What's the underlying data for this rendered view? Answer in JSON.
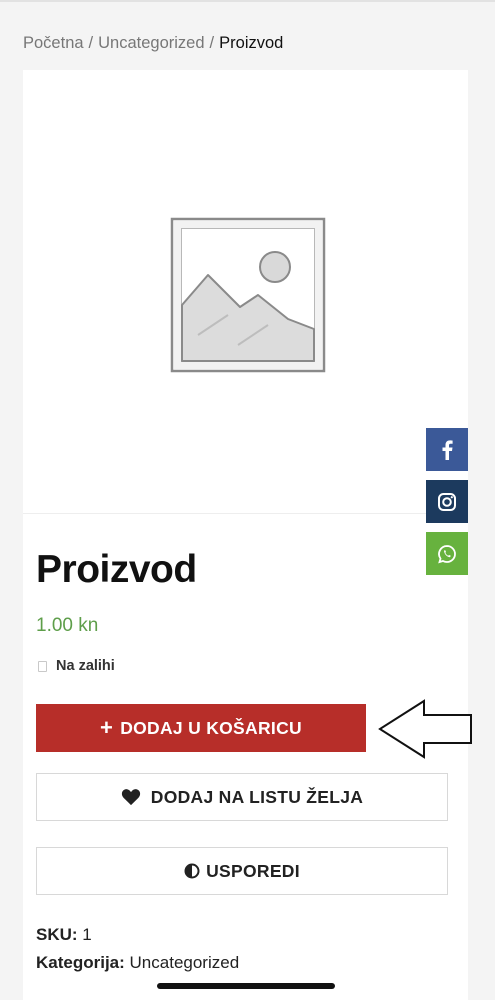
{
  "breadcrumb": {
    "home": "Početna",
    "separator": "/",
    "category": "Uncategorized",
    "current": "Proizvod"
  },
  "product": {
    "title": "Proizvod",
    "price": "1.00 kn",
    "stock": "Na zalihi",
    "add_to_cart_label": "DODAJ U KOŠARICU",
    "wishlist_label": "DODAJ NA LISTU ŽELJA",
    "compare_label": "USPOREDI",
    "sku_label": "SKU:",
    "sku_value": "1",
    "category_label": "Kategorija:",
    "category_value": "Uncategorized"
  },
  "social": [
    {
      "icon": "facebook-icon",
      "color": "#3b5998"
    },
    {
      "icon": "instagram-icon",
      "color": "#1c3a5e"
    },
    {
      "icon": "whatsapp-icon",
      "color": "#67b23e"
    }
  ],
  "colors": {
    "accent": "#b72e29",
    "price": "#5e9e4a",
    "background": "#f4f4f4"
  },
  "icons": {
    "cart_icon": "plus-icon",
    "wishlist_icon": "heart-icon",
    "compare_icon": "half-circle-icon",
    "annotation": "arrow-left-icon",
    "image": "image-placeholder-icon"
  }
}
